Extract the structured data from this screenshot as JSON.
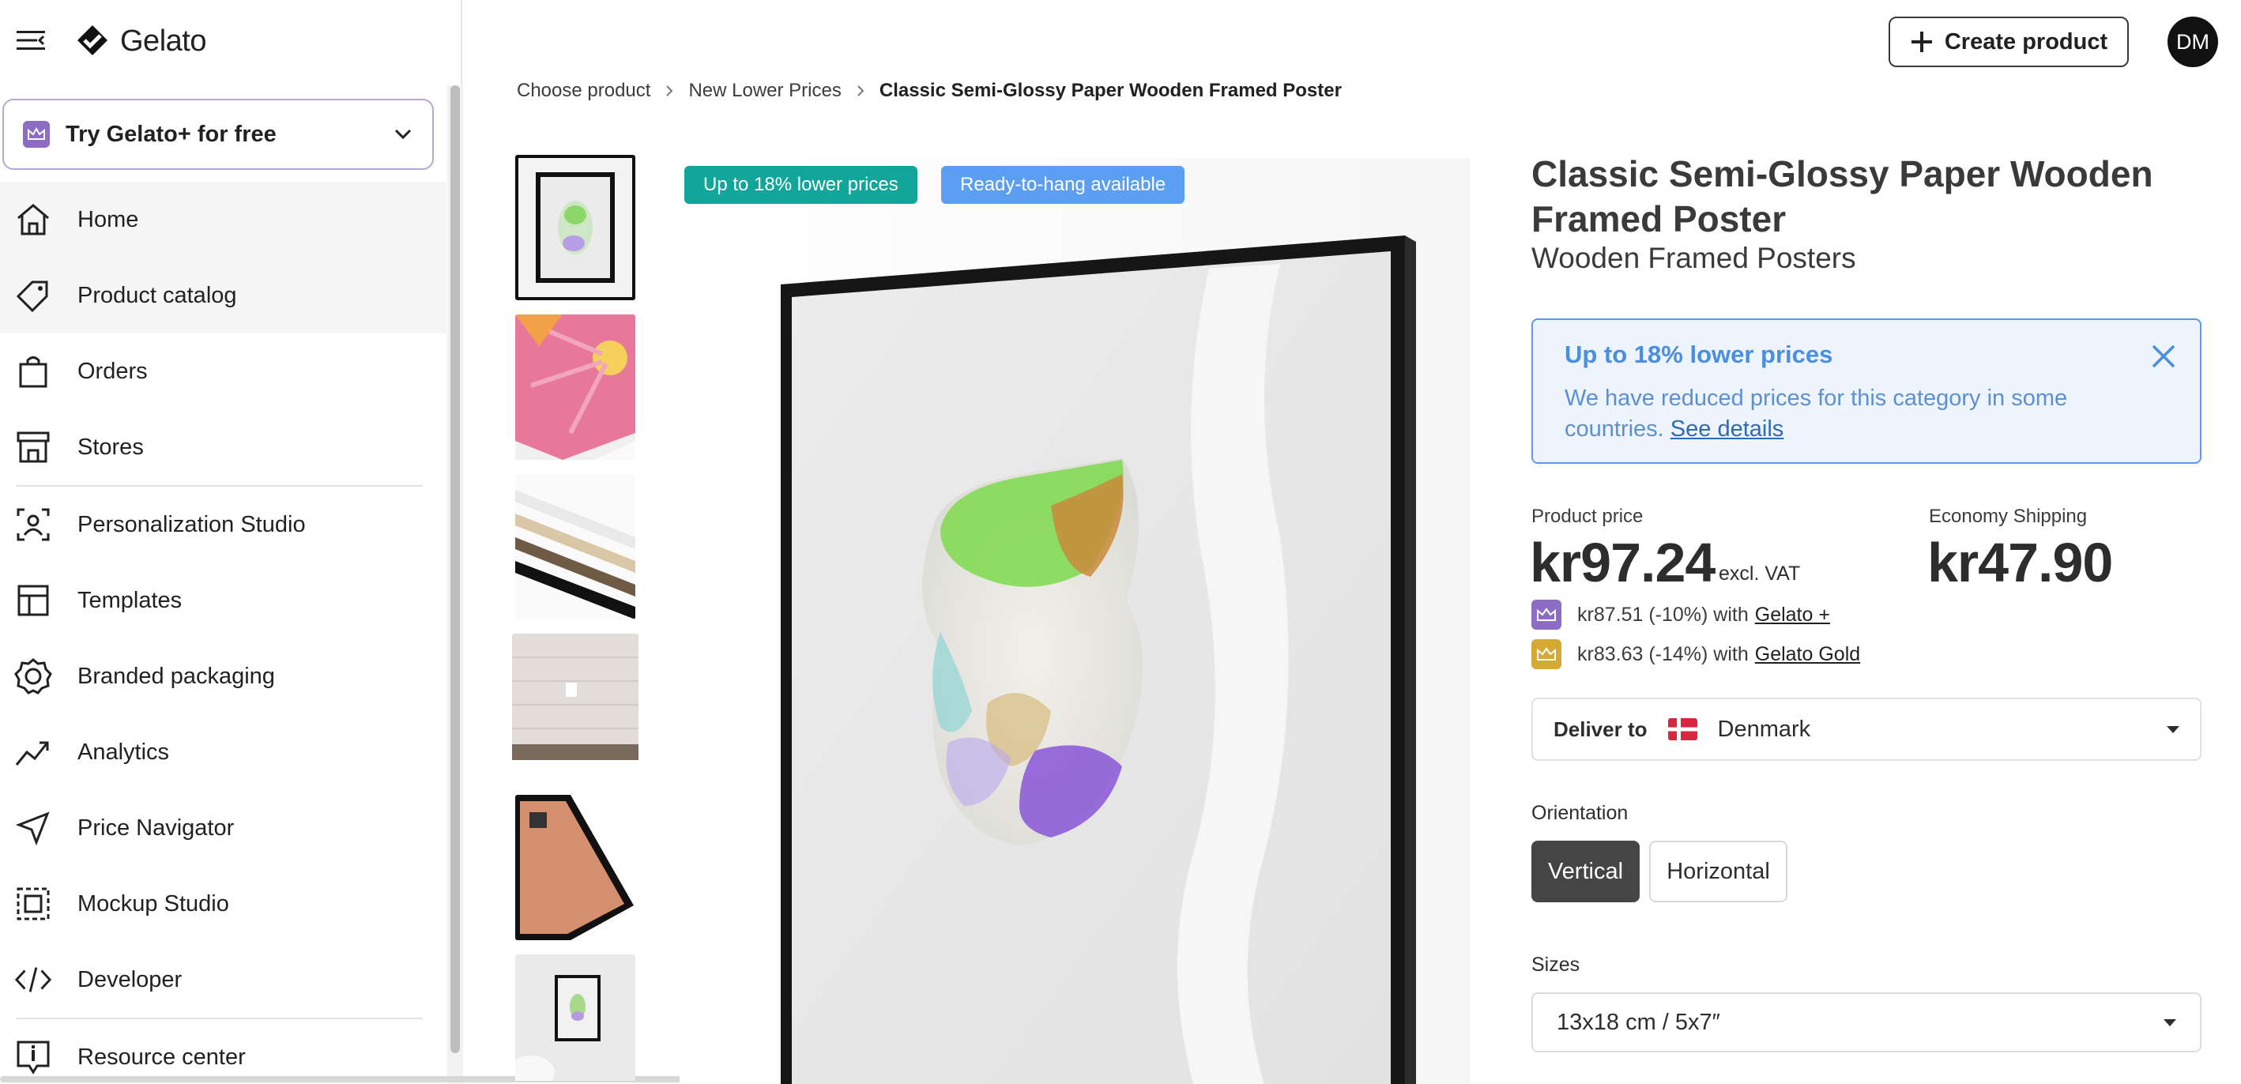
{
  "app": {
    "name": "Gelato"
  },
  "header": {
    "create_label": "Create product",
    "avatar_initials": "DM"
  },
  "sidebar": {
    "promo_label": "Try Gelato+ for free",
    "items": [
      {
        "label": "Home",
        "icon": "home-icon"
      },
      {
        "label": "Product catalog",
        "icon": "tag-icon"
      },
      {
        "label": "Orders",
        "icon": "shopping-bag-icon"
      },
      {
        "label": "Stores",
        "icon": "store-icon"
      },
      {
        "label": "Personalization Studio",
        "icon": "personalization-icon"
      },
      {
        "label": "Templates",
        "icon": "template-icon"
      },
      {
        "label": "Branded packaging",
        "icon": "badge-icon"
      },
      {
        "label": "Analytics",
        "icon": "analytics-icon"
      },
      {
        "label": "Price Navigator",
        "icon": "navigation-arrow-icon"
      },
      {
        "label": "Mockup Studio",
        "icon": "mockup-icon"
      },
      {
        "label": "Developer",
        "icon": "code-icon"
      },
      {
        "label": "Resource center",
        "icon": "info-icon"
      }
    ]
  },
  "breadcrumb": {
    "items": [
      "Choose product",
      "New Lower Prices"
    ],
    "current": "Classic Semi-Glossy Paper Wooden Framed Poster"
  },
  "gallery": {
    "badges": [
      "Up to 18% lower prices",
      "Ready-to-hang available"
    ],
    "thumbnail_count": 6
  },
  "product": {
    "title": "Classic Semi-Glossy Paper Wooden Framed Poster",
    "subtitle": "Wooden Framed Posters",
    "notice": {
      "title": "Up to 18% lower prices",
      "text": "We have reduced prices for this category in some countries.",
      "link": "See details"
    },
    "price": {
      "label": "Product price",
      "value": "kr97.24",
      "vat_note": "excl. VAT",
      "shipping_label": "Economy Shipping",
      "shipping_value": "kr47.90",
      "plus_text": "kr87.51 (-10%) with",
      "plus_link": "Gelato +",
      "gold_text": "kr83.63 (-14%) with",
      "gold_link": "Gelato Gold"
    },
    "deliver": {
      "label": "Deliver to",
      "country": "Denmark"
    },
    "orientation": {
      "label": "Orientation",
      "options": [
        "Vertical",
        "Horizontal"
      ],
      "selected": "Vertical"
    },
    "sizes": {
      "label": "Sizes",
      "selected": "13x18 cm / 5x7″"
    }
  },
  "colors": {
    "teal": "#12a59a",
    "blue": "#5c9ff2",
    "plus_purple": "#8c6cc4",
    "gold": "#d4a935"
  }
}
